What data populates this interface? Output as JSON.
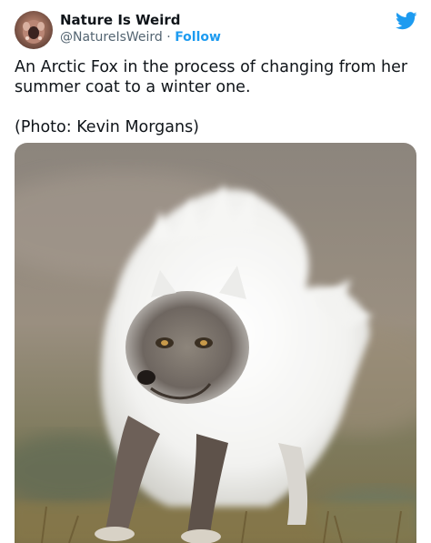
{
  "tweet": {
    "author_name": "Nature Is Weird",
    "handle": "@NatureIsWeird",
    "separator": "·",
    "follow_label": "Follow",
    "text_line": "An Arctic Fox in the process of changing from her summer coat to a winter one.",
    "credit_line": "(Photo: Kevin Morgans)"
  },
  "icons": {
    "logo": "twitter-bird-icon",
    "avatar": "profile-avatar"
  },
  "colors": {
    "accent": "#1d9bf0",
    "text": "#0f1419",
    "secondary": "#536471"
  }
}
